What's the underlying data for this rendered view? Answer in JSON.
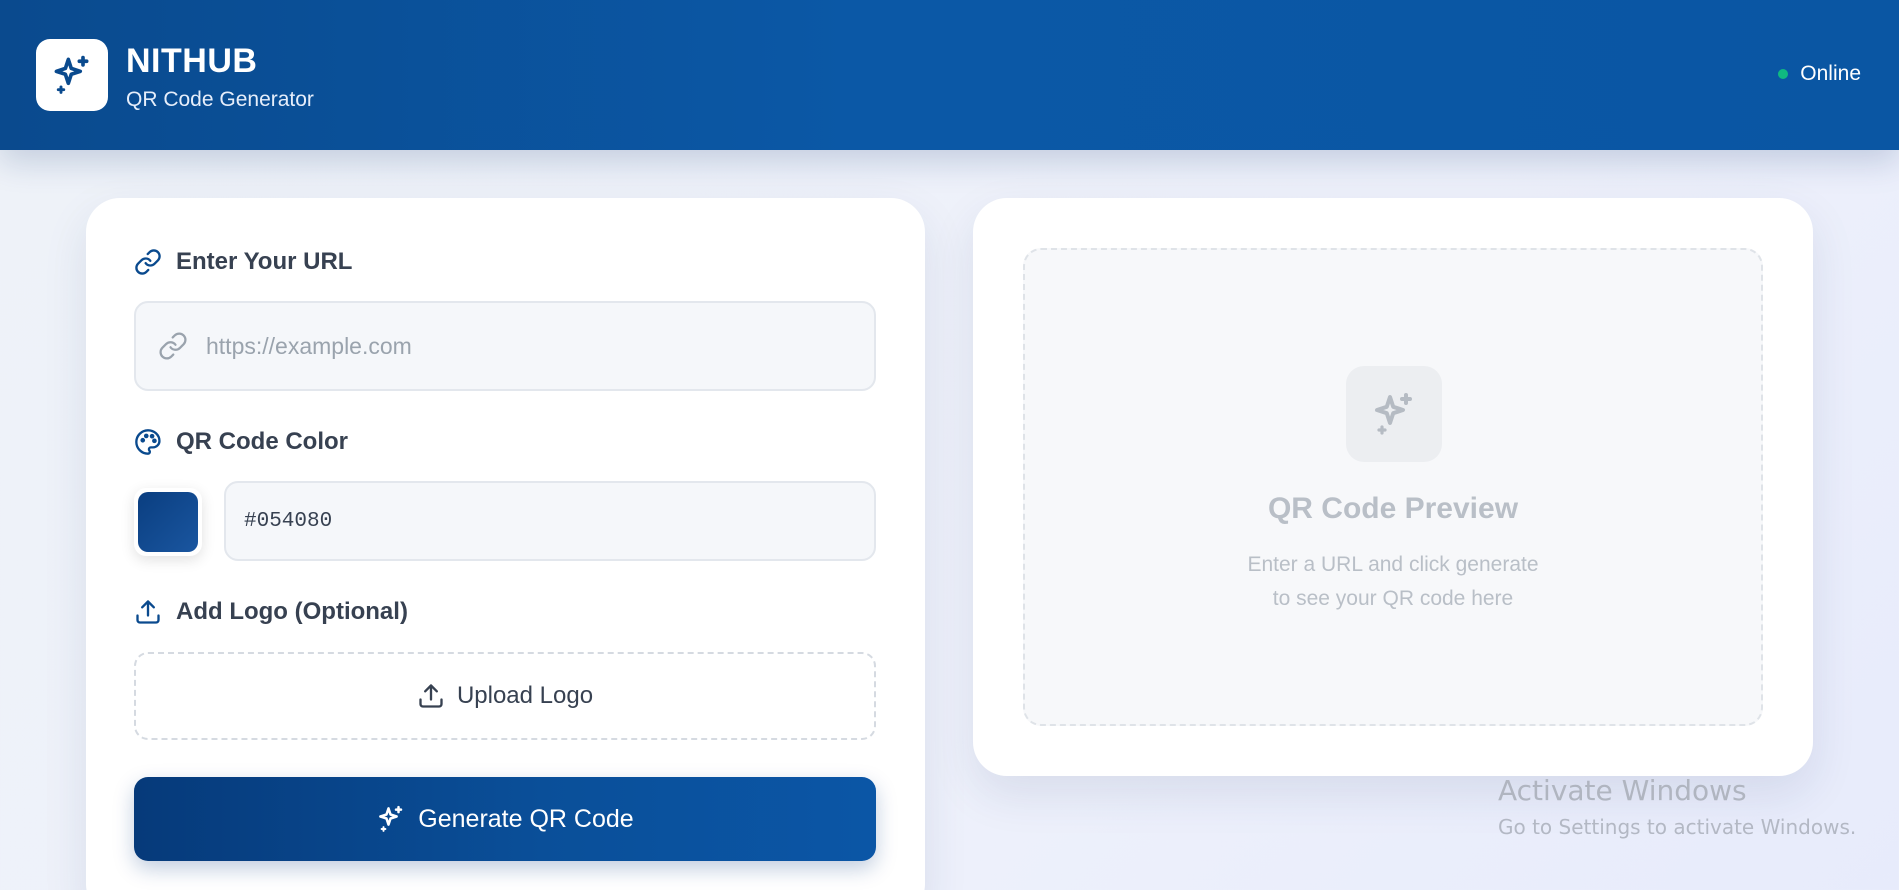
{
  "header": {
    "brand_name": "NITHUB",
    "brand_subtitle": "QR Code Generator",
    "logo_icon": "sparkles-icon",
    "status_text": "Online",
    "status_color": "#10b981",
    "background_color": "#0a56a3"
  },
  "form": {
    "url_label": "Enter Your URL",
    "url_placeholder": "https://example.com",
    "url_value": "",
    "color_label": "QR Code Color",
    "color_value": "#054080",
    "logo_label": "Add Logo (Optional)",
    "upload_label": "Upload Logo",
    "generate_label": "Generate QR Code"
  },
  "preview": {
    "title": "QR Code Preview",
    "description_line1": "Enter a URL and click generate",
    "description_line2": "to see your QR code here",
    "icon": "sparkles-icon"
  },
  "watermark": {
    "title": "Activate Windows",
    "subtitle": "Go to Settings to activate Windows."
  },
  "colors": {
    "primary": "#0a4a8e",
    "accent_green": "#10b981",
    "swatch": "#054080"
  }
}
